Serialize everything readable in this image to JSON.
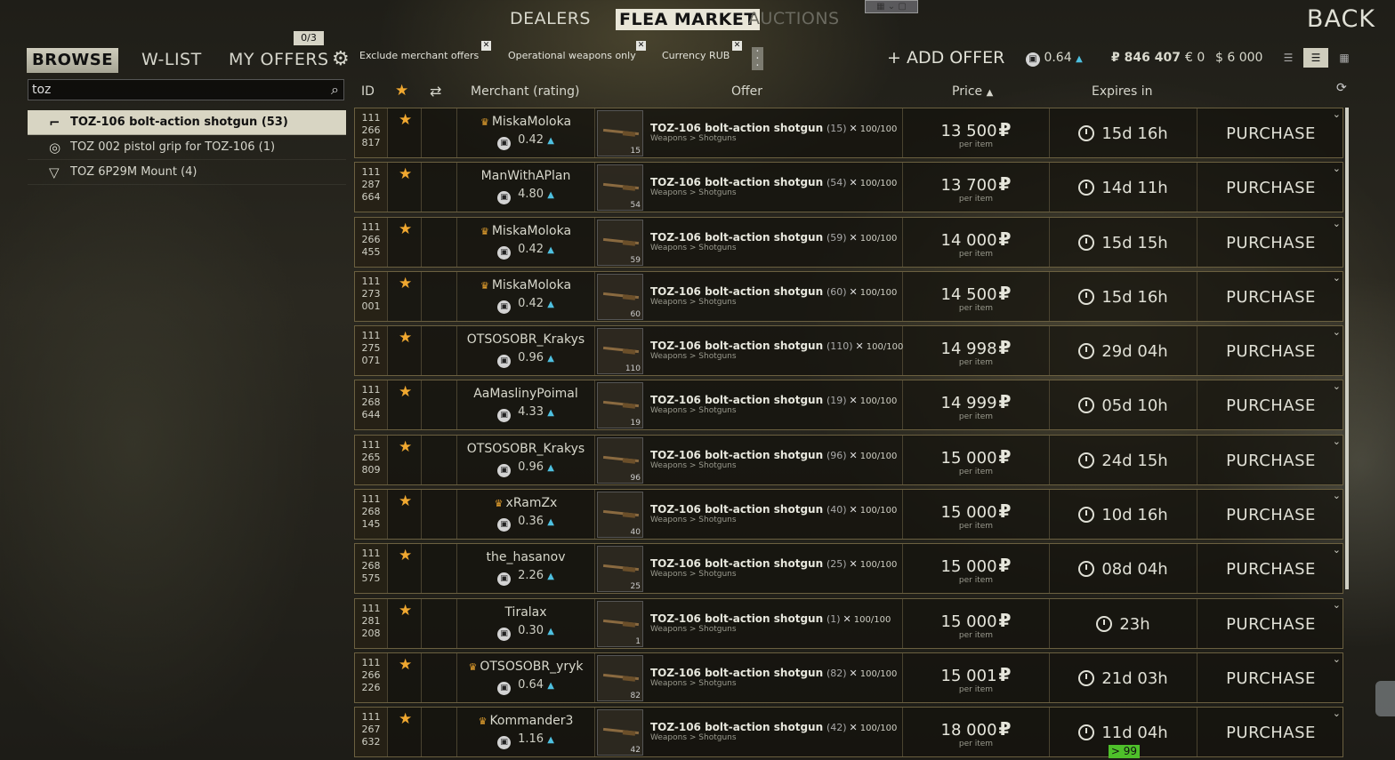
{
  "top_nav": {
    "dealers": "DEALERS",
    "flea_market": "FLEA MARKET",
    "auctions": "AUCTIONS",
    "back": "BACK"
  },
  "tabs": {
    "browse": "BROWSE",
    "wlist": "W-LIST",
    "my_offers": "MY OFFERS",
    "offer_count": "0/3"
  },
  "filters": [
    {
      "label": "Exclude merchant offers"
    },
    {
      "label": "Operational weapons only"
    },
    {
      "label": "Currency RUB"
    }
  ],
  "add_offer": "+ ADD OFFER",
  "balances": {
    "rating": "0.64",
    "rub": "₽ 846 407",
    "eur": "€ 0",
    "usd": "$ 6 000"
  },
  "search": {
    "value": "toz",
    "placeholder": ""
  },
  "sidebar": {
    "items": [
      {
        "label": "TOZ-106 bolt-action shotgun (53)",
        "icon": "shotgun-icon"
      },
      {
        "label": "TOZ 002 pistol grip for TOZ-106 (1)",
        "icon": "grip-icon"
      },
      {
        "label": "TOZ 6P29M Mount (4)",
        "icon": "mount-icon"
      }
    ]
  },
  "table": {
    "headers": {
      "id": "ID",
      "merchant": "Merchant (rating)",
      "offer": "Offer",
      "price": "Price",
      "expires": "Expires in"
    },
    "rows": [
      {
        "id": [
          "111",
          "266",
          "817"
        ],
        "merchant": "MiskaMoloka",
        "crown": true,
        "rating": "0.42",
        "item": "TOZ-106 bolt-action shotgun",
        "qty": "(15)",
        "dur": "100/100",
        "category": "Weapons > Shotguns",
        "count": "15",
        "price": "13 500",
        "per": "per item",
        "expires": "15d 16h",
        "action": "PURCHASE"
      },
      {
        "id": [
          "111",
          "287",
          "664"
        ],
        "merchant": "ManWithAPlan",
        "crown": false,
        "rating": "4.80",
        "item": "TOZ-106 bolt-action shotgun",
        "qty": "(54)",
        "dur": "100/100",
        "category": "Weapons > Shotguns",
        "count": "54",
        "price": "13 700",
        "per": "per item",
        "expires": "14d 11h",
        "action": "PURCHASE"
      },
      {
        "id": [
          "111",
          "266",
          "455"
        ],
        "merchant": "MiskaMoloka",
        "crown": true,
        "rating": "0.42",
        "item": "TOZ-106 bolt-action shotgun",
        "qty": "(59)",
        "dur": "100/100",
        "category": "Weapons > Shotguns",
        "count": "59",
        "price": "14 000",
        "per": "per item",
        "expires": "15d 15h",
        "action": "PURCHASE"
      },
      {
        "id": [
          "111",
          "273",
          "001"
        ],
        "merchant": "MiskaMoloka",
        "crown": true,
        "rating": "0.42",
        "item": "TOZ-106 bolt-action shotgun",
        "qty": "(60)",
        "dur": "100/100",
        "category": "Weapons > Shotguns",
        "count": "60",
        "price": "14 500",
        "per": "per item",
        "expires": "15d 16h",
        "action": "PURCHASE"
      },
      {
        "id": [
          "111",
          "275",
          "071"
        ],
        "merchant": "OTSOSOBR_Krakys",
        "crown": false,
        "rating": "0.96",
        "item": "TOZ-106 bolt-action shotgun",
        "qty": "(110)",
        "dur": "100/100",
        "category": "Weapons > Shotguns",
        "count": "110",
        "price": "14 998",
        "per": "per item",
        "expires": "29d 04h",
        "action": "PURCHASE"
      },
      {
        "id": [
          "111",
          "268",
          "644"
        ],
        "merchant": "AaMaslinyPoimal",
        "crown": false,
        "rating": "4.33",
        "item": "TOZ-106 bolt-action shotgun",
        "qty": "(19)",
        "dur": "100/100",
        "category": "Weapons > Shotguns",
        "count": "19",
        "price": "14 999",
        "per": "per item",
        "expires": "05d 10h",
        "action": "PURCHASE"
      },
      {
        "id": [
          "111",
          "265",
          "809"
        ],
        "merchant": "OTSOSOBR_Krakys",
        "crown": false,
        "rating": "0.96",
        "item": "TOZ-106 bolt-action shotgun",
        "qty": "(96)",
        "dur": "100/100",
        "category": "Weapons > Shotguns",
        "count": "96",
        "price": "15 000",
        "per": "per item",
        "expires": "24d 15h",
        "action": "PURCHASE"
      },
      {
        "id": [
          "111",
          "268",
          "145"
        ],
        "merchant": "xRamZx",
        "crown": true,
        "rating": "0.36",
        "item": "TOZ-106 bolt-action shotgun",
        "qty": "(40)",
        "dur": "100/100",
        "category": "Weapons > Shotguns",
        "count": "40",
        "price": "15 000",
        "per": "per item",
        "expires": "10d 16h",
        "action": "PURCHASE"
      },
      {
        "id": [
          "111",
          "268",
          "575"
        ],
        "merchant": "the_hasanov",
        "crown": false,
        "rating": "2.26",
        "item": "TOZ-106 bolt-action shotgun",
        "qty": "(25)",
        "dur": "100/100",
        "category": "Weapons > Shotguns",
        "count": "25",
        "price": "15 000",
        "per": "per item",
        "expires": "08d 04h",
        "action": "PURCHASE"
      },
      {
        "id": [
          "111",
          "281",
          "208"
        ],
        "merchant": "Tiralax",
        "crown": false,
        "rating": "0.30",
        "item": "TOZ-106 bolt-action shotgun",
        "qty": "(1)",
        "dur": "100/100",
        "category": "Weapons > Shotguns",
        "count": "1",
        "price": "15 000",
        "per": "per item",
        "expires": "23h",
        "action": "PURCHASE"
      },
      {
        "id": [
          "111",
          "266",
          "226"
        ],
        "merchant": "OTSOSOBR_yryk",
        "crown": true,
        "rating": "0.64",
        "item": "TOZ-106 bolt-action shotgun",
        "qty": "(82)",
        "dur": "100/100",
        "category": "Weapons > Shotguns",
        "count": "82",
        "price": "15 001",
        "per": "per item",
        "expires": "21d 03h",
        "action": "PURCHASE"
      },
      {
        "id": [
          "111",
          "267",
          "632"
        ],
        "merchant": "Kommander3",
        "crown": true,
        "rating": "1.16",
        "item": "TOZ-106 bolt-action shotgun",
        "qty": "(42)",
        "dur": "100/100",
        "category": "Weapons > Shotguns",
        "count": "42",
        "price": "18 000",
        "per": "per item",
        "expires": "11d 04h",
        "action": "PURCHASE"
      }
    ]
  },
  "badge": "> 99",
  "colors": {
    "accent_gold": "#f0a830",
    "rating_up": "#4ec0e0",
    "badge_green": "#4ec02a"
  }
}
